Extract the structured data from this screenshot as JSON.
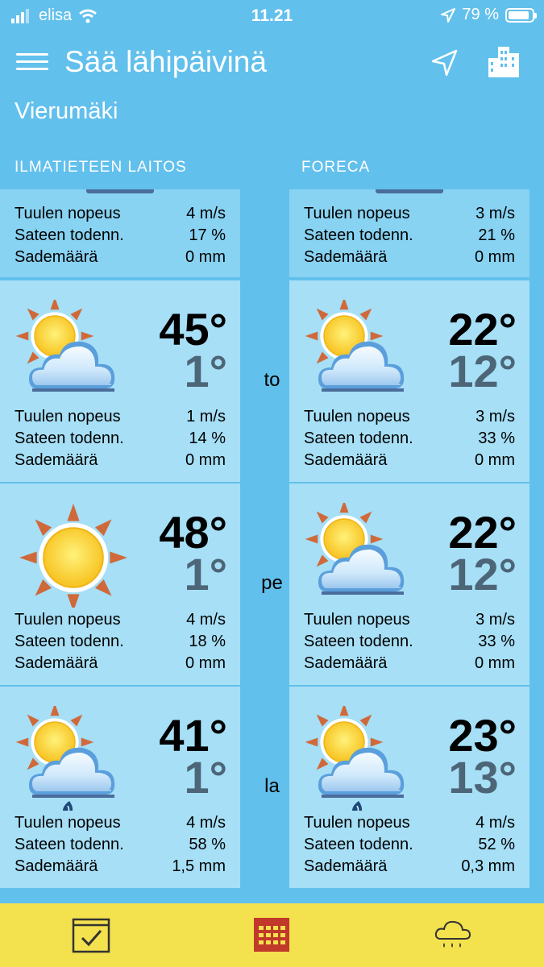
{
  "status_bar": {
    "carrier": "elisa",
    "time": "11.21",
    "battery": "79 %"
  },
  "app_bar": {
    "title": "Sää lähipäivinä",
    "location": "Vierumäki"
  },
  "sources": {
    "left": "ILMATIETEEN LAITOS",
    "right": "FORECA"
  },
  "labels": {
    "wind": "Tuulen nopeus",
    "rain_chance": "Sateen todenn.",
    "rain_amount": "Sademäärä"
  },
  "partial": {
    "fmi": {
      "wind": "4 m/s",
      "rain_chance": "17 %",
      "rain_amount": "0 mm"
    },
    "foreca": {
      "wind": "3 m/s",
      "rain_chance": "21 %",
      "rain_amount": "0 mm"
    }
  },
  "days": [
    {
      "day": "to",
      "fmi": {
        "icon": "sun-cloud-icon",
        "tmax": "45°",
        "tmin": "1°",
        "wind": "1 m/s",
        "rain_chance": "14 %",
        "rain_amount": "0 mm"
      },
      "foreca": {
        "icon": "sun-cloud-icon",
        "tmax": "22°",
        "tmin": "12°",
        "wind": "3 m/s",
        "rain_chance": "33 %",
        "rain_amount": "0 mm"
      }
    },
    {
      "day": "pe",
      "fmi": {
        "icon": "sun-icon",
        "tmax": "48°",
        "tmin": "1°",
        "wind": "4 m/s",
        "rain_chance": "18 %",
        "rain_amount": "0 mm"
      },
      "foreca": {
        "icon": "sun-cloud-icon",
        "tmax": "22°",
        "tmin": "12°",
        "wind": "3 m/s",
        "rain_chance": "33 %",
        "rain_amount": "0 mm"
      }
    },
    {
      "day": "la",
      "fmi": {
        "icon": "sun-cloud-rain-icon",
        "tmax": "41°",
        "tmin": "1°",
        "wind": "4 m/s",
        "rain_chance": "58 %",
        "rain_amount": "1,5 mm"
      },
      "foreca": {
        "icon": "sun-cloud-rain-icon",
        "tmax": "23°",
        "tmin": "13°",
        "wind": "4 m/s",
        "rain_chance": "52 %",
        "rain_amount": "0,3 mm"
      }
    }
  ],
  "tabbar": {
    "tabs": [
      "checklist-calendar-icon",
      "calendar-grid-icon",
      "rain-cloud-icon"
    ],
    "active_color": "#c0392b"
  },
  "colors": {
    "background": "#62c0ec",
    "card_dark": "#88d2f2",
    "card_light": "#a6dff6",
    "tabbar": "#f3e14e"
  }
}
